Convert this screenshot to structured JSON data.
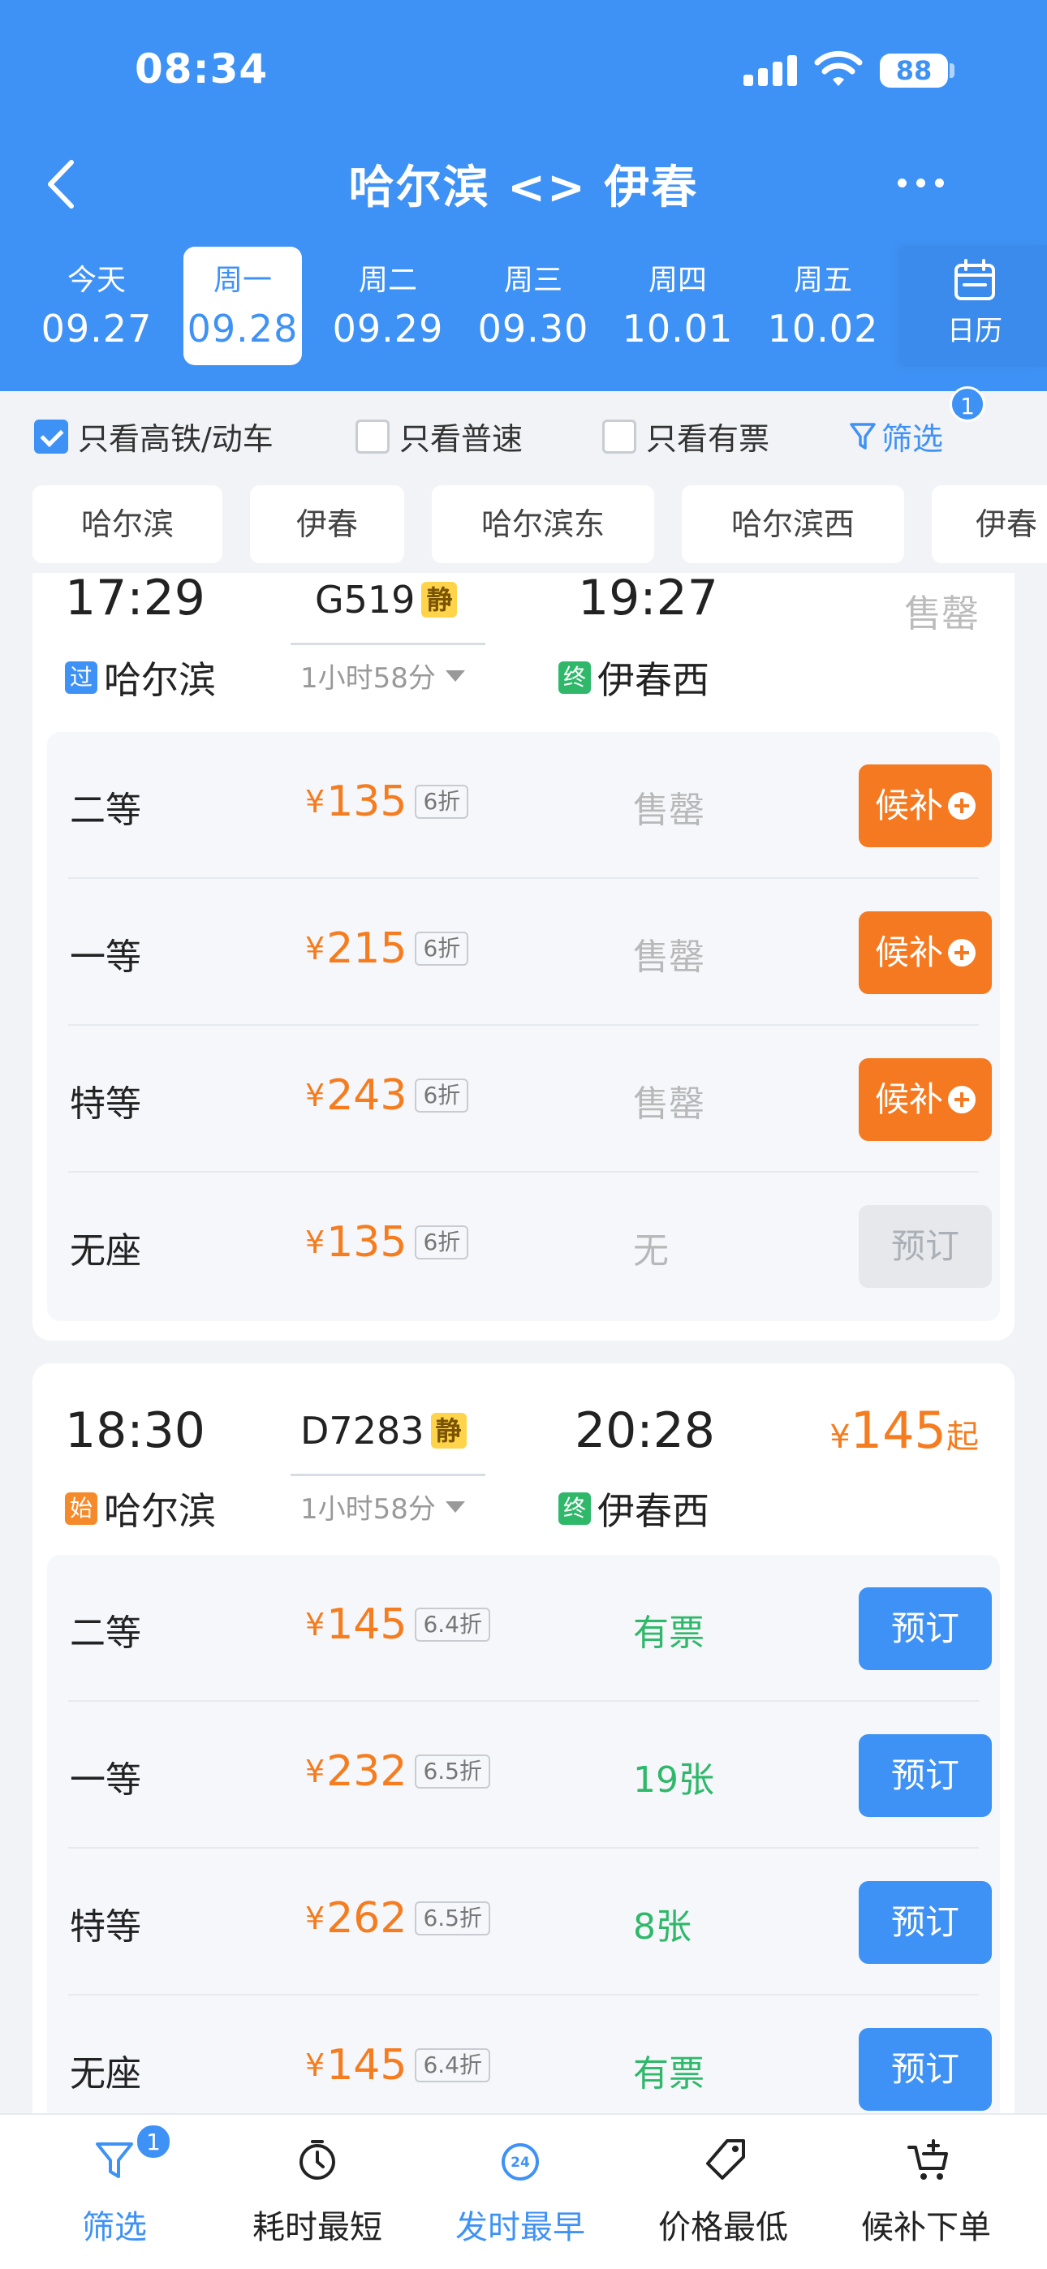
{
  "status": {
    "time": "08:34",
    "battery": "88"
  },
  "header": {
    "title": "哈尔滨 <> 伊春"
  },
  "dates": [
    {
      "weekday": "今天",
      "date": "09.27",
      "active": false
    },
    {
      "weekday": "周一",
      "date": "09.28",
      "active": true
    },
    {
      "weekday": "周二",
      "date": "09.29",
      "active": false
    },
    {
      "weekday": "周三",
      "date": "09.30",
      "active": false
    },
    {
      "weekday": "周四",
      "date": "10.01",
      "active": false
    },
    {
      "weekday": "周五",
      "date": "10.02",
      "active": false
    }
  ],
  "calendar_label": "日历",
  "filters": {
    "high_speed_only": {
      "label": "只看高铁/动车",
      "checked": true
    },
    "normal_only": {
      "label": "只看普速",
      "checked": false
    },
    "available_only": {
      "label": "只看有票",
      "checked": false
    },
    "filter_label": "筛选",
    "filter_count": "1"
  },
  "stations": [
    "哈尔滨",
    "伊春",
    "哈尔滨东",
    "哈尔滨西",
    "伊春"
  ],
  "trains": [
    {
      "dep_time": "17:29",
      "code": "G519",
      "quiet_tag": "静",
      "arr_time": "19:27",
      "duration": "1小时58分",
      "from_tag": "过",
      "from": "哈尔滨",
      "to_tag": "终",
      "to": "伊春西",
      "summary": "售罄",
      "seats": [
        {
          "class": "二等",
          "yen": "¥",
          "price": "135",
          "discount": "6折",
          "availability": "售罄",
          "action": "候补"
        },
        {
          "class": "一等",
          "yen": "¥",
          "price": "215",
          "discount": "6折",
          "availability": "售罄",
          "action": "候补"
        },
        {
          "class": "特等",
          "yen": "¥",
          "price": "243",
          "discount": "6折",
          "availability": "售罄",
          "action": "候补"
        },
        {
          "class": "无座",
          "yen": "¥",
          "price": "135",
          "discount": "6折",
          "availability": "无",
          "action": "预订"
        }
      ]
    },
    {
      "dep_time": "18:30",
      "code": "D7283",
      "quiet_tag": "静",
      "arr_time": "20:28",
      "duration": "1小时58分",
      "from_tag": "始",
      "from": "哈尔滨",
      "to_tag": "终",
      "to": "伊春西",
      "summary_yen": "¥",
      "summary_price": "145",
      "summary_suffix": "起",
      "seats": [
        {
          "class": "二等",
          "yen": "¥",
          "price": "145",
          "discount": "6.4折",
          "availability": "有票",
          "action": "预订"
        },
        {
          "class": "一等",
          "yen": "¥",
          "price": "232",
          "discount": "6.5折",
          "availability": "19张",
          "action": "预订"
        },
        {
          "class": "特等",
          "yen": "¥",
          "price": "262",
          "discount": "6.5折",
          "availability": "8张",
          "action": "预订"
        },
        {
          "class": "无座",
          "yen": "¥",
          "price": "145",
          "discount": "6.4折",
          "availability": "有票",
          "action": "预订"
        }
      ]
    }
  ],
  "bottom_nav": [
    {
      "label": "筛选",
      "icon": "filter-icon",
      "badge": "1",
      "active": true
    },
    {
      "label": "耗时最短",
      "icon": "clock-icon",
      "active": false
    },
    {
      "label": "发时最早",
      "icon": "24h-clock-icon",
      "icon_text": "24",
      "active": true
    },
    {
      "label": "价格最低",
      "icon": "price-tag-icon",
      "active": false
    },
    {
      "label": "候补下单",
      "icon": "cart-add-icon",
      "active": false
    }
  ],
  "colors": {
    "brand_blue": "#3f92f5",
    "orange": "#f47920",
    "green": "#2fb86a"
  }
}
